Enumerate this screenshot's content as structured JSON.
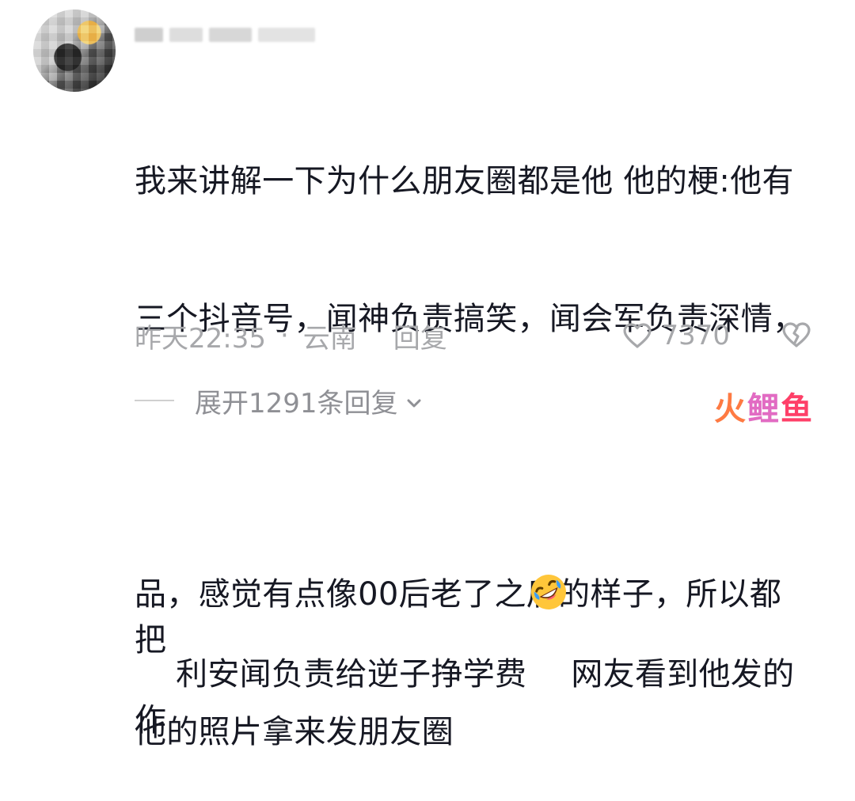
{
  "comment": {
    "lines": [
      "我来讲解一下为什么朋友圈都是他 他的梗:他有",
      "三个抖音号，闻神负责搞笑，闻会军负责深情，",
      "利安闻负责给逆子挣学费",
      "网友看到他发的作",
      "品，感觉有点像00后老了之后的样子，所以都把",
      "他的照片拿来发朋友圈"
    ]
  },
  "meta": {
    "time": "昨天22:35",
    "dot": "·",
    "location": "云南",
    "reply": "回复"
  },
  "actions": {
    "like_count": "7370"
  },
  "replies": {
    "expand_label": "展开1291条回复"
  },
  "icons": {
    "emoji": "rofl-emoji",
    "heart": "heart-icon",
    "dislike": "broken-heart-icon",
    "chevron": "chevron-down-icon"
  },
  "watermark": {
    "part1": "火",
    "part2": "鲤",
    "part3": "鱼"
  },
  "colors": {
    "text_main": "#161823",
    "text_muted": "#a7a8ab",
    "emoji_yellow": "#ffc63a",
    "emoji_blue": "#3d9ff2",
    "watermark_orange": "#ff7a42",
    "watermark_pink": "#e26bc3",
    "watermark_red": "#ff3f68"
  }
}
